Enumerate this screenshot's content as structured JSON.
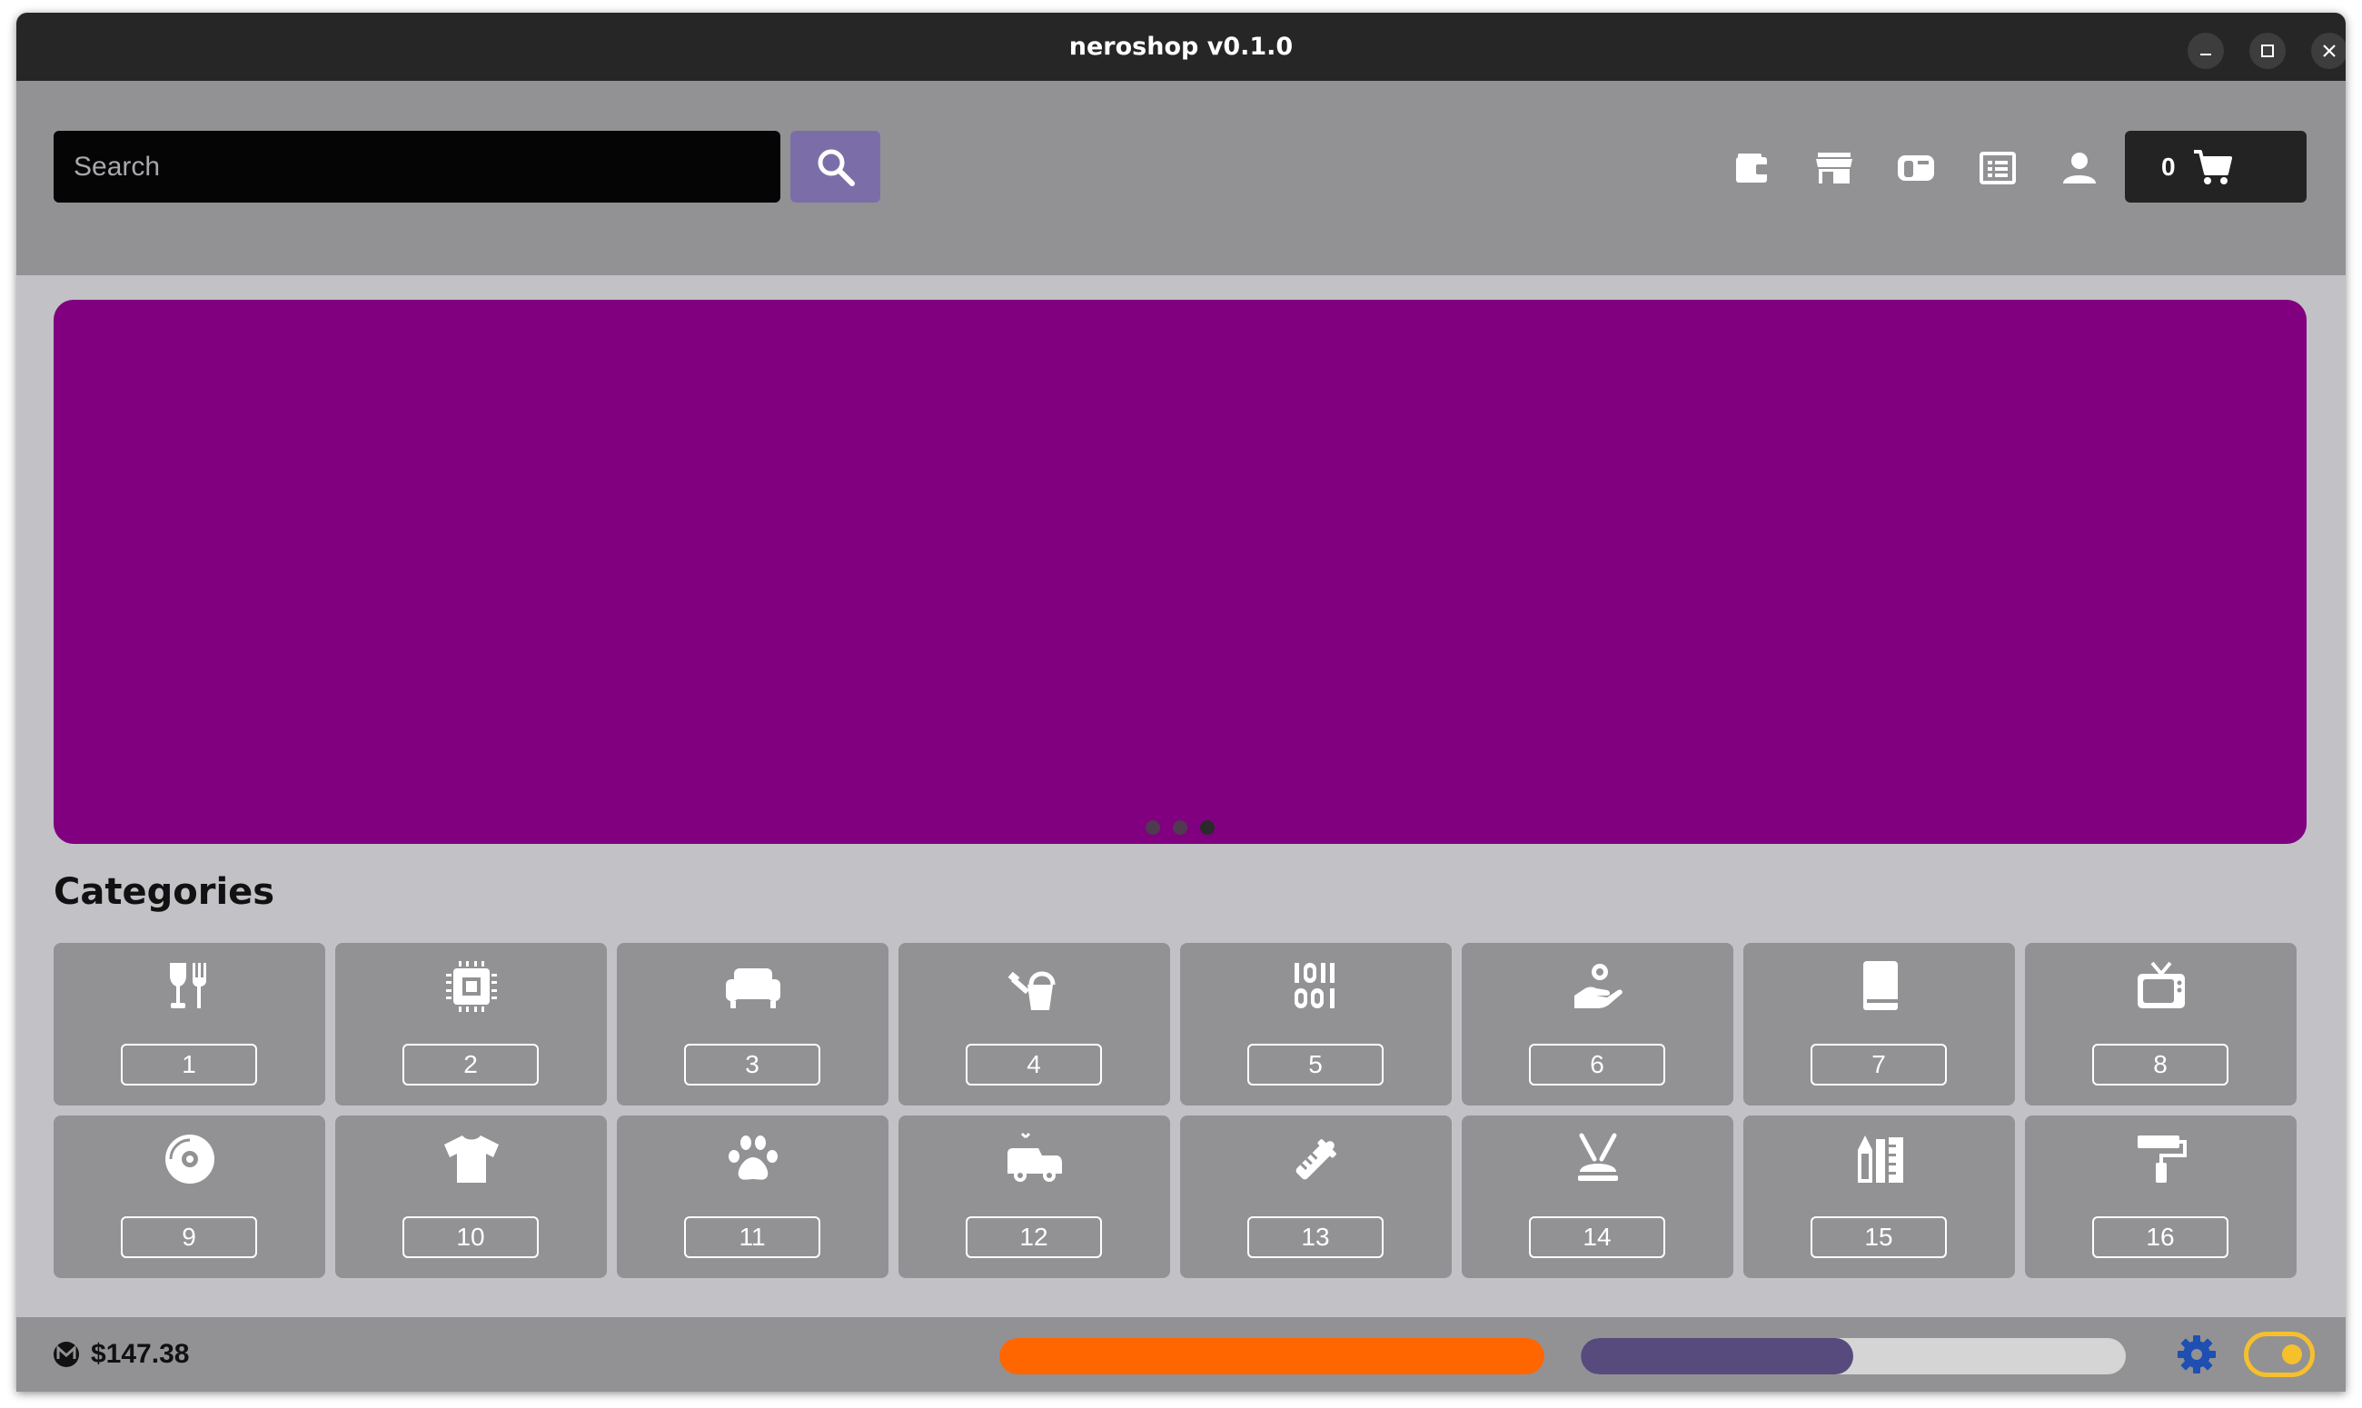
{
  "window": {
    "title": "neroshop v0.1.0"
  },
  "header": {
    "search_placeholder": "Search",
    "cart_count": "0",
    "nav_icons": [
      "wallet-icon",
      "store-icon",
      "inbox-icon",
      "orders-icon",
      "user-icon"
    ]
  },
  "banner": {
    "color": "#800080",
    "slide_count": 3,
    "active_slide": 3
  },
  "categories": {
    "heading": "Categories",
    "items": [
      {
        "label": "1",
        "icon": "food-drink-icon"
      },
      {
        "label": "2",
        "icon": "electronics-chip-icon"
      },
      {
        "label": "3",
        "icon": "furniture-sofa-icon"
      },
      {
        "label": "4",
        "icon": "garden-watering-can-icon"
      },
      {
        "label": "5",
        "icon": "digital-binary-icon"
      },
      {
        "label": "6",
        "icon": "services-hand-icon"
      },
      {
        "label": "7",
        "icon": "books-icon"
      },
      {
        "label": "8",
        "icon": "tv-icon"
      },
      {
        "label": "9",
        "icon": "music-disc-icon"
      },
      {
        "label": "10",
        "icon": "clothing-tshirt-icon"
      },
      {
        "label": "11",
        "icon": "pets-paw-icon"
      },
      {
        "label": "12",
        "icon": "toys-car-icon"
      },
      {
        "label": "13",
        "icon": "baby-bottle-icon"
      },
      {
        "label": "14",
        "icon": "beauty-icon"
      },
      {
        "label": "15",
        "icon": "office-supplies-icon"
      },
      {
        "label": "16",
        "icon": "home-improvement-paint-roller-icon"
      }
    ]
  },
  "statusbar": {
    "balance": "$147.38",
    "sync_progress": 1.0,
    "sync_color": "#ff6600",
    "daemon_progress": 0.5,
    "daemon_color": "#574b7e",
    "daemon_track_color": "#d5d5d5",
    "theme_toggle_color": "#f5c02c",
    "gear_color": "#1f4fb0"
  }
}
